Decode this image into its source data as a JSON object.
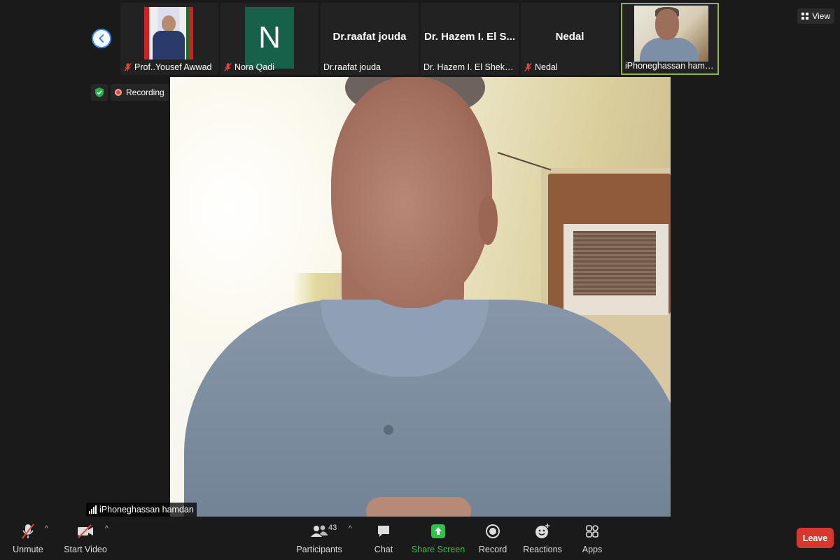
{
  "participants_strip": [
    {
      "name": "Prof. Yousef Awwad",
      "caption": "Prof..Yousef Awwad",
      "type": "photo",
      "muted": true
    },
    {
      "name": "Nora Qadi",
      "caption": "Nora Qadi",
      "type": "initial",
      "initial": "N",
      "avatar_color": "#17604a",
      "muted": true
    },
    {
      "name": "Dr.raafat jouda",
      "caption": "Dr.raafat jouda",
      "display": "Dr.raafat jouda",
      "type": "name",
      "muted": false
    },
    {
      "name": "Dr. Hazem I. El Shekh Ah...",
      "caption": "Dr. Hazem I. El Shekh Ah...",
      "display": "Dr. Hazem I. El S...",
      "type": "name",
      "muted": false
    },
    {
      "name": "Nedal",
      "caption": "Nedal",
      "display": "Nedal",
      "type": "name",
      "muted": true
    },
    {
      "name": "iPhoneghassan hamdan",
      "caption": "iPhoneghassan hamdan",
      "type": "photo",
      "active": true,
      "muted": false
    }
  ],
  "view_button": {
    "label": "View"
  },
  "status": {
    "recording_label": "Recording"
  },
  "main_video": {
    "speaker_name": "iPhoneghassan hamdan"
  },
  "toolbar": {
    "unmute": "Unmute",
    "start_video": "Start Video",
    "participants": "Participants",
    "participants_count": "43",
    "chat": "Chat",
    "share_screen": "Share Screen",
    "record": "Record",
    "reactions": "Reactions",
    "apps": "Apps",
    "leave": "Leave"
  },
  "colors": {
    "background": "#1a1a1a",
    "active_speaker_border": "#8db83b",
    "leave": "#d7372f",
    "share_screen": "#30c14a",
    "recording": "#e8443a",
    "nav_button_border": "#2d8cff"
  },
  "icons": [
    "chevron-left-icon",
    "mic-off-icon",
    "grid-icon",
    "shield-check-icon",
    "record-dot-icon",
    "signal-bars-icon",
    "video-off-icon",
    "participants-icon",
    "chat-icon",
    "share-screen-icon",
    "record-icon",
    "reactions-icon",
    "apps-icon",
    "caret-up-icon"
  ]
}
